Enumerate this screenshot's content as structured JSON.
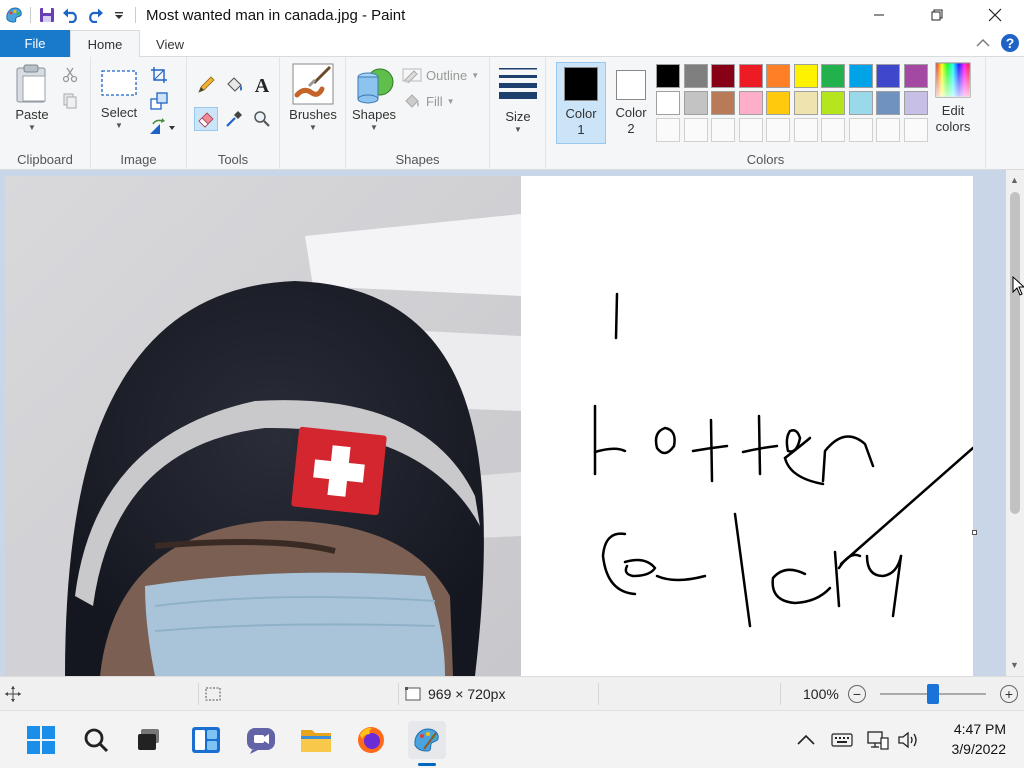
{
  "window": {
    "title": "Most wanted man in canada.jpg - Paint"
  },
  "tabs": {
    "file": "File",
    "home": "Home",
    "view": "View"
  },
  "ribbon": {
    "clipboard": {
      "label": "Clipboard",
      "paste": "Paste"
    },
    "image": {
      "label": "Image",
      "select": "Select"
    },
    "tools": {
      "label": "Tools"
    },
    "brushes": {
      "label": "Brushes"
    },
    "shapes": {
      "label": "Shapes",
      "shapes_btn": "Shapes",
      "outline": "Outline",
      "fill": "Fill"
    },
    "size": {
      "label": "Size"
    },
    "colors": {
      "label": "Colors",
      "color1_line1": "Color",
      "color1_line2": "1",
      "color2_line1": "Color",
      "color2_line2": "2",
      "edit_line1": "Edit",
      "edit_line2": "colors",
      "color1_value": "#000000",
      "color2_value": "#ffffff",
      "palette_row1": [
        "#000000",
        "#7f7f7f",
        "#880015",
        "#ed1c24",
        "#ff7f27",
        "#fff200",
        "#22b14c",
        "#00a2e8",
        "#3f48cc",
        "#a349a4"
      ],
      "palette_row2": [
        "#ffffff",
        "#c3c3c3",
        "#b97a57",
        "#ffaec9",
        "#ffc90e",
        "#efe4b0",
        "#b5e61d",
        "#99d9ea",
        "#7092be",
        "#c8bfe7"
      ]
    }
  },
  "status": {
    "dimensions": "969 × 720px",
    "zoom": "100%",
    "zoom_level": 1.0
  },
  "taskbar": {
    "time": "4:47 PM",
    "date": "3/9/2022"
  }
}
